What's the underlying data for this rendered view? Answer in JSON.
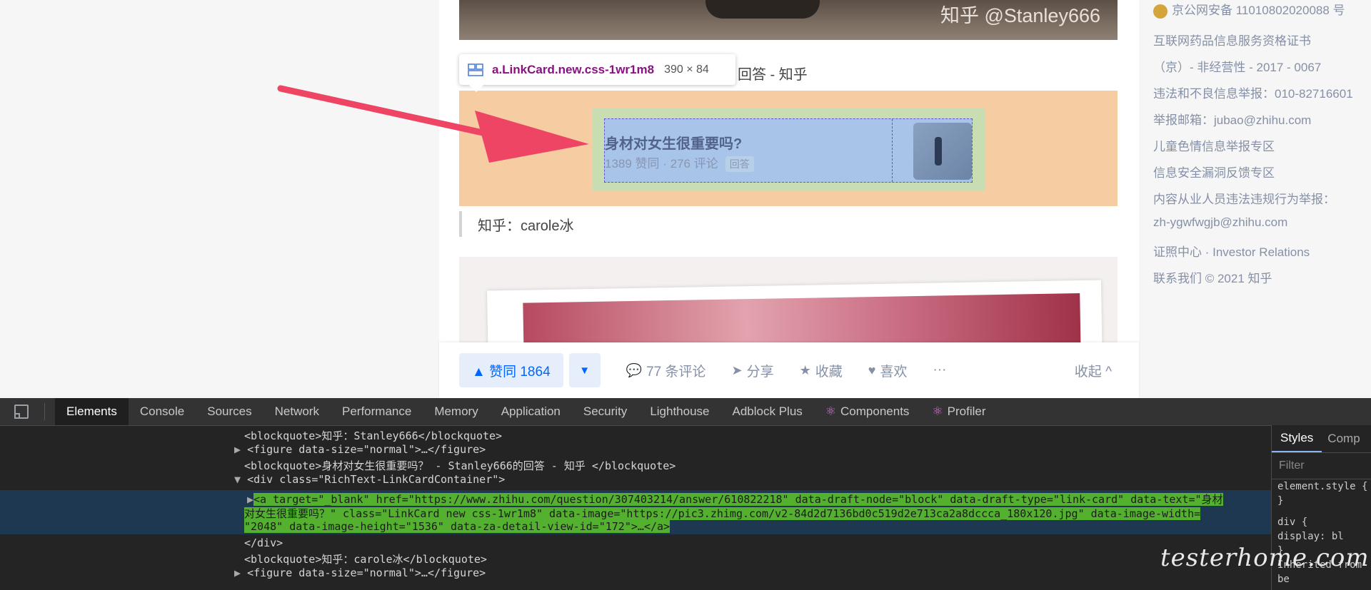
{
  "photo_watermark": "知乎 @Stanley666",
  "tooltip": {
    "selector": "a.LinkCard.new.css-1wr1m8",
    "dimensions": "390 × 84"
  },
  "quote_suffix": "回答 - 知乎",
  "link_card": {
    "title": "身材对女生很重要吗?",
    "meta": "1389 赞同 · 276 评论",
    "tag": "回答"
  },
  "blockquote2": "知乎：carole冰",
  "actions": {
    "upvote": "▲ 赞同 1864",
    "downvote": "▼",
    "comments": "77 条评论",
    "share": "分享",
    "collect": "收藏",
    "like": "喜欢",
    "more": "···",
    "collapse": "收起 ^"
  },
  "sidebar": [
    "京公网安备 11010802020088 号",
    "互联网药品信息服务资格证书",
    "（京）- 非经营性 - 2017 - 0067",
    "违法和不良信息举报：010-82716601",
    "举报邮箱：jubao@zhihu.com",
    "儿童色情信息举报专区",
    "信息安全漏洞反馈专区",
    "内容从业人员违法违规行为举报：",
    "zh-ygwfwgjb@zhihu.com",
    "证照中心 · Investor Relations",
    "联系我们 © 2021 知乎"
  ],
  "devtools": {
    "tabs": [
      "Elements",
      "Console",
      "Sources",
      "Network",
      "Performance",
      "Memory",
      "Application",
      "Security",
      "Lighthouse",
      "Adblock Plus",
      "Components",
      "Profiler"
    ],
    "styles_tab": "Styles",
    "computed_tab": "Comp",
    "filter_placeholder": "Filter",
    "style_rules": [
      "element.style {",
      "}",
      "div {",
      "  display: bl",
      "}",
      "Inherited from be"
    ],
    "dom": {
      "l0": "<blockquote>知乎：Stanley666</blockquote>",
      "l1": "<figure data-size=\"normal\">…</figure>",
      "l2": "<blockquote>身材对女生很重要吗？ - Stanley666的回答 - 知乎 </blockquote>",
      "l3": "<div class=\"RichText-LinkCardContainer\">",
      "l4a": "<a target=\"_blank\" href=\"https://www.zhihu.com/question/307403214/answer/610822218\" data-draft-node=\"block\" data-draft-type=\"link-card\" data-text=\"身材",
      "l4b": "对女生很重要吗？\" class=\"LinkCard new css-1wr1m8\" data-image=\"https://pic3.zhimg.com/v2-84d2d7136bd0c519d2e713ca2a8dccca_180x120.jpg\" data-image-width=",
      "l4c": "\"2048\" data-image-height=\"1536\" data-za-detail-view-id=\"172\">…</a>",
      "l5": "</div>",
      "l6": "<blockquote>知乎：carole冰</blockquote>",
      "l7": "<figure data-size=\"normal\">…</figure>"
    }
  },
  "brand_watermark": "testerhome.com"
}
